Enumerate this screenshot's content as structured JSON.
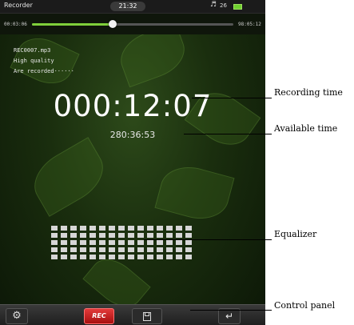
{
  "status_bar": {
    "app_title": "Recorder",
    "clock": "21:32",
    "volume_icon": "speaker-icon",
    "volume_level": "26",
    "battery_color": "#6fd12f"
  },
  "progress": {
    "elapsed": "00:03:06",
    "total": "98:05:12",
    "fraction": 0.4
  },
  "recording_info": {
    "filename": "REC0007.mp3",
    "quality": "High quality",
    "status": "Are recorded······"
  },
  "recording_time": "000:12:07",
  "available_time": "280:36:53",
  "equalizer": {
    "columns": 15,
    "rows": 5
  },
  "control_panel": {
    "settings_icon": "gear-icon",
    "rec_label": "REC",
    "save_icon": "save-icon",
    "back_icon": "back-arrow-icon"
  },
  "callouts": {
    "recording_time": "Recording time",
    "available_time": "Available time",
    "equalizer": "Equalizer",
    "control_panel": "Control panel"
  },
  "colors": {
    "accent_green": "#7fcf3a",
    "rec_red": "#d42020"
  }
}
